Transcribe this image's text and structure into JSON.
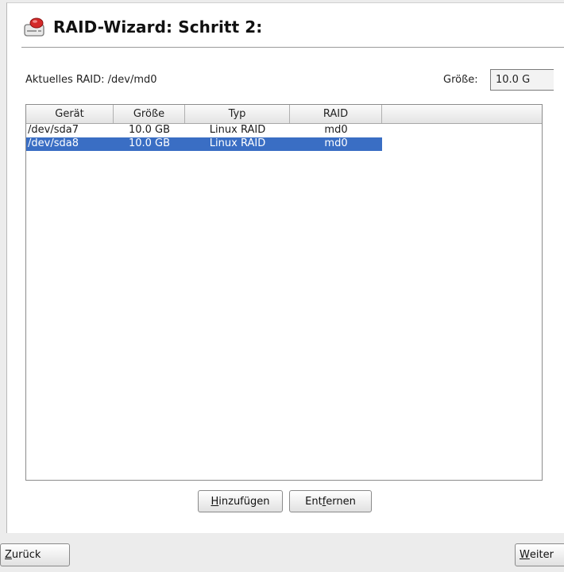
{
  "header": {
    "title": "RAID-Wizard: Schritt 2:",
    "icon": "raid-disk-icon"
  },
  "current_raid": {
    "label": "Aktuelles RAID: /dev/md0"
  },
  "size": {
    "label": "Größe:",
    "value": "10.0 G"
  },
  "table": {
    "columns": [
      "Gerät",
      "Größe",
      "Typ",
      "RAID",
      ""
    ],
    "rows": [
      {
        "device": "/dev/sda7",
        "size": "10.0 GB",
        "type": "Linux RAID",
        "raid": "md0",
        "selected": false
      },
      {
        "device": "/dev/sda8",
        "size": "10.0 GB",
        "type": "Linux RAID",
        "raid": "md0",
        "selected": true
      }
    ]
  },
  "buttons": {
    "add": {
      "mnemonic": "H",
      "rest": "inzufügen"
    },
    "remove": {
      "pre": "Ent",
      "mnemonic": "f",
      "rest": "ernen"
    },
    "back": {
      "mnemonic": "Z",
      "rest": "urück"
    },
    "next": {
      "mnemonic": "W",
      "rest": "eiter"
    }
  },
  "colors": {
    "selection": "#3a6ec4",
    "icon_red": "#d42a2a"
  }
}
